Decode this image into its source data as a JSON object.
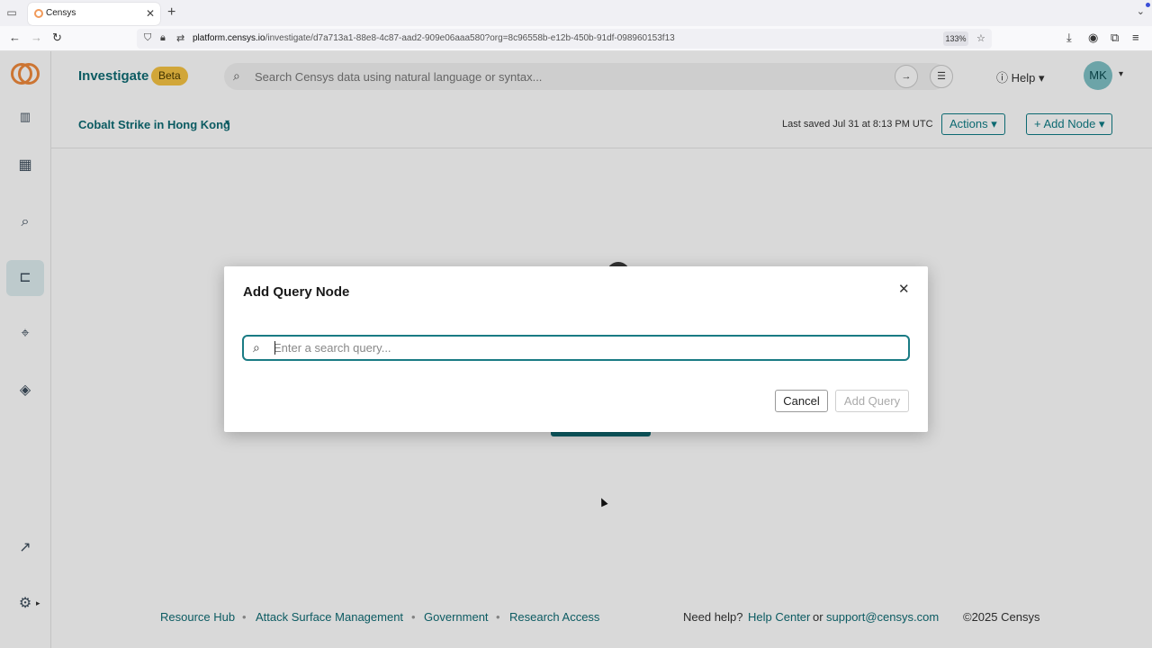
{
  "browser": {
    "tab_title": "Censys",
    "url_domain": "platform.censys.io",
    "url_path": "/investigate/d7a713a1-88e8-4c87-aad2-909e06aaa580?org=8c96558b-e12b-450b-91df-098960153f13",
    "zoom": "133%"
  },
  "header": {
    "brand": "Investigate",
    "badge": "Beta",
    "search_placeholder": "Search Censys data using natural language or syntax...",
    "help_label": "Help",
    "avatar_initials": "MK"
  },
  "subheader": {
    "investigation_title": "Cobalt Strike in Hong Kong",
    "last_saved": "Last saved Jul 31 at 8:13 PM UTC",
    "actions_label": "Actions",
    "add_node_label": "Add Node"
  },
  "modal": {
    "title": "Add Query Node",
    "input_placeholder": "Enter a search query...",
    "input_value": "",
    "cancel_label": "Cancel",
    "submit_label": "Add Query"
  },
  "footer": {
    "links": [
      "Resource Hub",
      "Attack Surface Management",
      "Government",
      "Research Access"
    ],
    "need_help": "Need help?",
    "help_center": "Help Center",
    "or": "or",
    "support_email": "support@censys.com",
    "copyright": "©2025 Censys"
  },
  "colors": {
    "accent": "#0f6c74",
    "badge": "#f6c343",
    "logo": "#f08a3c"
  }
}
